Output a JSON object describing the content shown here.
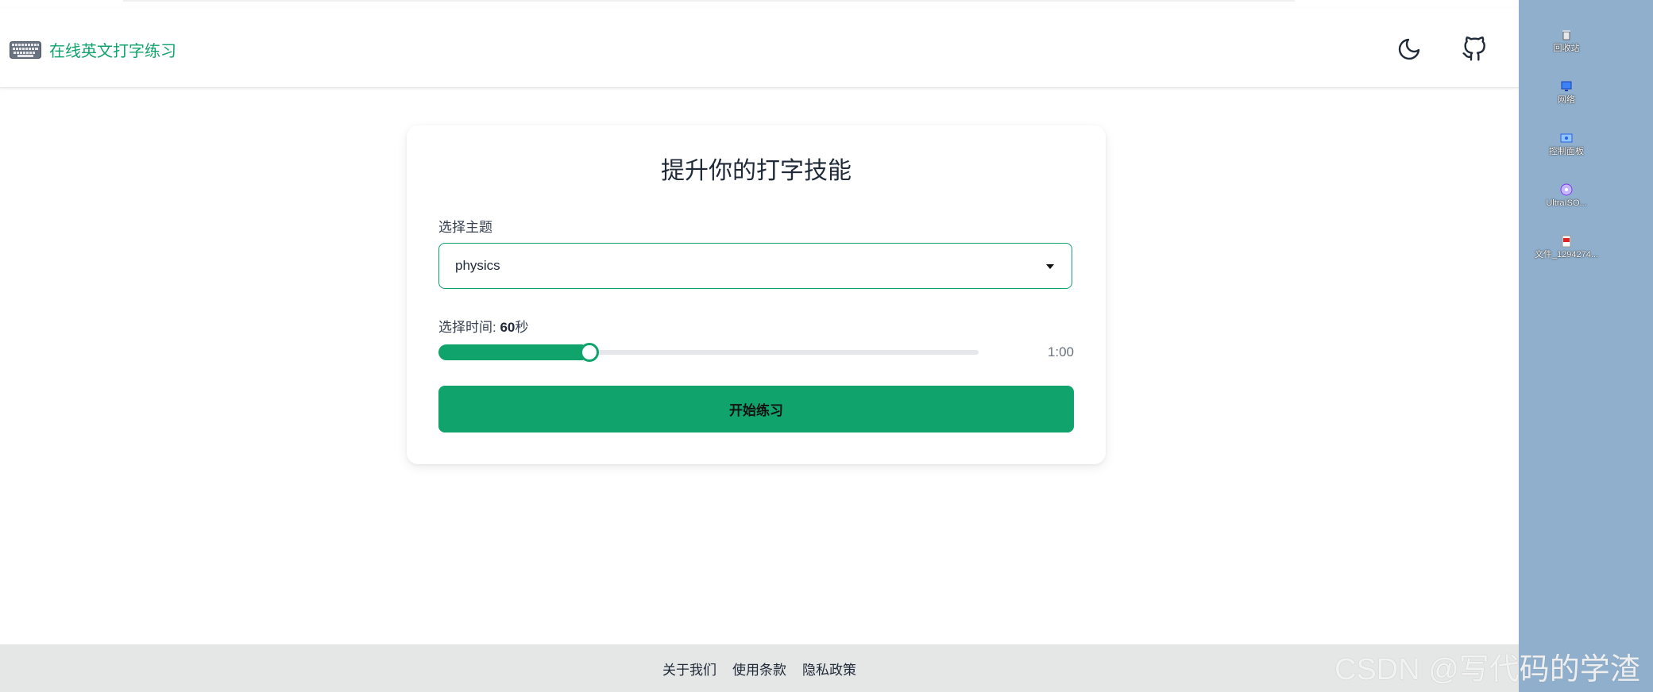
{
  "header": {
    "brand_title": "在线英文打字练习",
    "keyboard_icon": "keyboard-icon",
    "theme_toggle_icon": "moon-icon",
    "github_icon": "github-icon"
  },
  "card": {
    "title": "提升你的打字技能",
    "topic_label": "选择主题",
    "topic_selected": "physics",
    "time_label_prefix": "选择时间: ",
    "time_value": "60",
    "time_unit": "秒",
    "slider_display": "1:00",
    "slider_fraction": 0.28,
    "start_button": "开始练习"
  },
  "footer": {
    "links": [
      "关于我们",
      "使用条款",
      "隐私政策"
    ]
  },
  "desktop": {
    "items": [
      {
        "label": "回收站",
        "icon": "recycle-bin-icon"
      },
      {
        "label": "网络",
        "icon": "network-icon"
      },
      {
        "label": "控制面板",
        "icon": "control-panel-icon"
      },
      {
        "label": "UltraISO...",
        "icon": "ultraiso-icon"
      },
      {
        "label": "文件_1294274...",
        "icon": "pdf-file-icon"
      }
    ],
    "watermark": "CSDN @写代码的学渣"
  },
  "colors": {
    "accent": "#10a46c",
    "footer_bg": "#e5e7e6",
    "desktop_bg": "#8fafcc"
  }
}
